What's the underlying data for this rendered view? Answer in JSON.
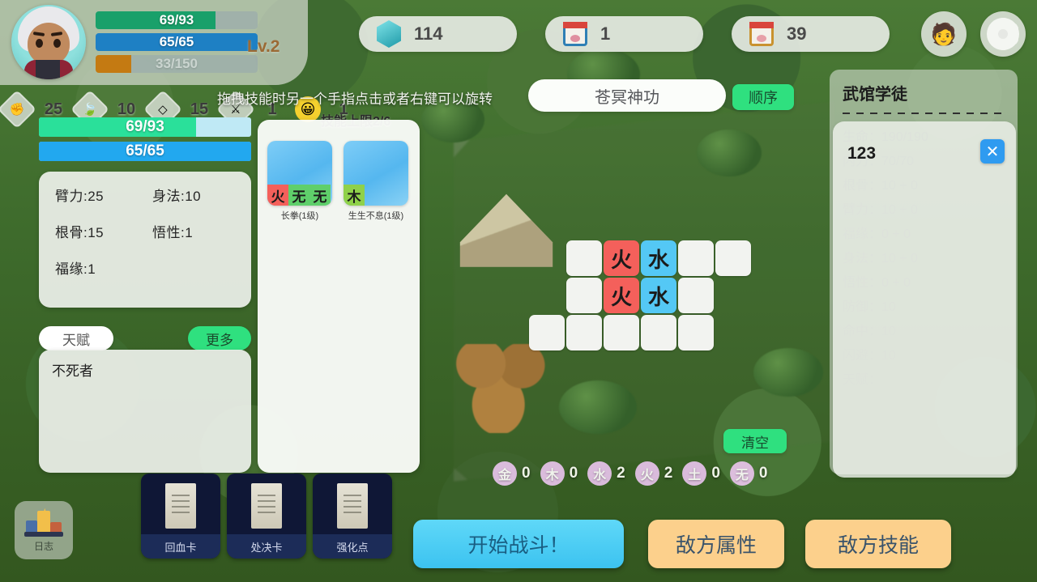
{
  "hero": {
    "level_label": "Lv.2",
    "bars": [
      {
        "name": "hp",
        "text": "69/93",
        "pct": 74,
        "color": "#19a06a"
      },
      {
        "name": "mp",
        "text": "65/65",
        "pct": 100,
        "color": "#1e80c4"
      },
      {
        "name": "exp",
        "text": "33/150",
        "pct": 22,
        "color": "#c47a12"
      }
    ]
  },
  "topbar": {
    "resources": [
      {
        "icon": "gem-icon",
        "value": "114"
      },
      {
        "icon": "calendar-icon",
        "value": "1"
      },
      {
        "icon": "calendar-gold-icon",
        "value": "39"
      }
    ],
    "avatar_button_icon": "faces-icon",
    "settings_button_icon": "gear-icon"
  },
  "stat_strip": [
    {
      "icon": "fist-icon",
      "glyph": "✊",
      "value": "25"
    },
    {
      "icon": "feather-icon",
      "glyph": "🍃",
      "value": "10"
    },
    {
      "icon": "shield-icon",
      "glyph": "◇",
      "value": "15"
    },
    {
      "icon": "sword-icon",
      "glyph": "⚔",
      "value": "1"
    },
    {
      "icon": "smiley-icon",
      "glyph": "😀",
      "value": "1"
    }
  ],
  "left_bars": [
    {
      "name": "hp",
      "text": "69/93",
      "pct": 74,
      "color": "#2ae09a"
    },
    {
      "name": "mp",
      "text": "65/65",
      "pct": 100,
      "color": "#22a8ef"
    }
  ],
  "attributes": [
    "臂力:25",
    "身法:10",
    "根骨:15",
    "悟性:1",
    "福缘:1",
    ""
  ],
  "talent": {
    "tab_label": "天赋",
    "more_label": "更多",
    "items": [
      "不死者"
    ]
  },
  "skills": {
    "cap_label": "技能上限2/6",
    "cards": [
      {
        "label": "长拳(1级)",
        "runes": [
          {
            "text": "火",
            "cls": "fire"
          },
          {
            "text": "无",
            "cls": "none"
          },
          {
            "text": "无",
            "cls": "none"
          }
        ]
      },
      {
        "label": "生生不息(1级)",
        "runes": [
          {
            "text": "木",
            "cls": "wood"
          }
        ]
      }
    ]
  },
  "hint_text": "拖拽技能时另一个手指点击或者右键可以旋转",
  "skill_name_bar": {
    "name": "苍冥神功",
    "order_label": "顺序"
  },
  "grid": {
    "rows": [
      [
        {
          "type": "empty"
        },
        {
          "type": "blank"
        },
        {
          "type": "fire",
          "text": "火"
        },
        {
          "type": "water",
          "text": "水"
        },
        {
          "type": "blank"
        },
        {
          "type": "blank"
        }
      ],
      [
        {
          "type": "empty"
        },
        {
          "type": "blank"
        },
        {
          "type": "fire",
          "text": "火"
        },
        {
          "type": "water",
          "text": "水"
        },
        {
          "type": "blank"
        },
        {
          "type": "empty"
        }
      ],
      [
        {
          "type": "blank"
        },
        {
          "type": "blank"
        },
        {
          "type": "blank"
        },
        {
          "type": "blank"
        },
        {
          "type": "blank"
        },
        {
          "type": "empty"
        }
      ]
    ]
  },
  "clear_label": "清空",
  "elements": [
    {
      "name": "金",
      "count": "0"
    },
    {
      "name": "木",
      "count": "0"
    },
    {
      "name": "水",
      "count": "2"
    },
    {
      "name": "火",
      "count": "2"
    },
    {
      "name": "土",
      "count": "0"
    },
    {
      "name": "无",
      "count": "0"
    }
  ],
  "card_slots": [
    {
      "label": "回血卡"
    },
    {
      "label": "处决卡"
    },
    {
      "label": "强化点"
    }
  ],
  "buttons": {
    "start_battle": "开始战斗！",
    "enemy_attributes": "敌方属性",
    "enemy_skills": "敌方技能"
  },
  "log_button": {
    "label": "日志",
    "icon": "podium-icon"
  },
  "enemy_panel": {
    "name": "武馆学徒",
    "stats": [
      "生命：190/190",
      "内力：70/70",
      "根骨：10 + 0",
      "臂力：10 + 0",
      "福缘：0 + 0",
      "身法：10 + 0",
      "悟性：0 + 0",
      "防御：10",
      "命中：10",
      "闪避：10",
      "天赋："
    ],
    "overlay_text": "123",
    "overlay_close_icon": "close-icon"
  }
}
